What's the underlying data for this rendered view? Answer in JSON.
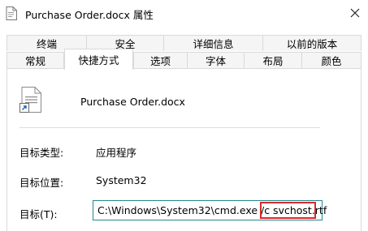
{
  "window": {
    "title": "Purchase Order.docx 属性",
    "close_glyph": "✕"
  },
  "tabs": {
    "row1": [
      "终端",
      "安全",
      "详细信息",
      "以前的版本"
    ],
    "row2": [
      "常规",
      "快捷方式",
      "选项",
      "字体",
      "布局",
      "颜色"
    ],
    "active": "快捷方式"
  },
  "shortcut": {
    "file_name": "Purchase Order.docx",
    "target_type_label": "目标类型:",
    "target_type_value": "应用程序",
    "target_location_label": "目标位置:",
    "target_location_value": "System32",
    "target_label": "目标(T):",
    "target_value": "C:\\Windows\\System32\\cmd.exe /c svchost.rtf",
    "target_highlight": "svchost.rtf"
  },
  "colors": {
    "accent_border": "#23868e",
    "highlight_border": "#d42d2d"
  }
}
